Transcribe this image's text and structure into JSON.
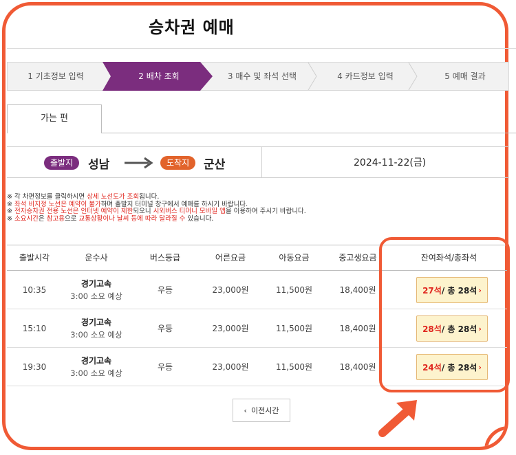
{
  "page": {
    "title": "승차권 예매"
  },
  "steps": [
    {
      "label": "1 기초정보 입력",
      "active": false
    },
    {
      "label": "2 배차 조회",
      "active": true
    },
    {
      "label": "3 매수 및 좌석 선택",
      "active": false
    },
    {
      "label": "4 카드정보 입력",
      "active": false
    },
    {
      "label": "5 예매 결과",
      "active": false
    }
  ],
  "tab": {
    "label": "가는 편"
  },
  "route": {
    "departure_badge": "출발지",
    "departure_city": "성남",
    "arrival_badge": "도착지",
    "arrival_city": "군산",
    "date": "2024-11-22(금)"
  },
  "notes": {
    "n1": {
      "a": "※ 각 차편정보를 클릭하시면 ",
      "b": "상세 노선도가 조회",
      "c": "됩니다."
    },
    "n2": {
      "a": "※ ",
      "b": "좌석 비지정 노선은 예약이 불가",
      "c": "하며 출발지 터미널 창구에서 예매를 하시기 바랍니다."
    },
    "n3": {
      "a": "※ ",
      "b": "전자승차권 전용 노선은 인터넷 예약이 제한",
      "c": "되오니 ",
      "d": "시외버스 티머니 모바일 앱",
      "e": "을 이용하여 주시기 바랍니다."
    },
    "n4": {
      "a": "※ ",
      "b": "소요시간",
      "c": "은 ",
      "d": "참고용",
      "e": "으로 ",
      "f": "교통상황이나 날씨 등에 따라 달라질 수",
      "g": " 있습니다."
    }
  },
  "table": {
    "headers": [
      "출발시각",
      "운수사",
      "버스등급",
      "어른요금",
      "아동요금",
      "중고생요금",
      "잔여좌석/총좌석"
    ],
    "rows": [
      {
        "time": "10:35",
        "company": "경기고속",
        "duration": "3:00 소요 예상",
        "grade": "우등",
        "adult": "23,000원",
        "child": "11,500원",
        "student": "18,400원",
        "remaining": "27석",
        "total": " / 총 28석"
      },
      {
        "time": "15:10",
        "company": "경기고속",
        "duration": "3:00 소요 예상",
        "grade": "우등",
        "adult": "23,000원",
        "child": "11,500원",
        "student": "18,400원",
        "remaining": "28석",
        "total": " / 총 28석"
      },
      {
        "time": "19:30",
        "company": "경기고속",
        "duration": "3:00 소요 예상",
        "grade": "우등",
        "adult": "23,000원",
        "child": "11,500원",
        "student": "18,400원",
        "remaining": "24석",
        "total": " / 총 28석"
      }
    ]
  },
  "prev_button": {
    "label": "이전시간"
  },
  "colors": {
    "accent_purple": "#7b2d7e",
    "accent_orange": "#e2632b",
    "highlight": "#f05a35",
    "alert_red": "#e0271f"
  },
  "icons": {
    "arrow": "right-arrow-icon",
    "chevron": "chevron-right-icon",
    "back": "chevron-left-icon"
  }
}
